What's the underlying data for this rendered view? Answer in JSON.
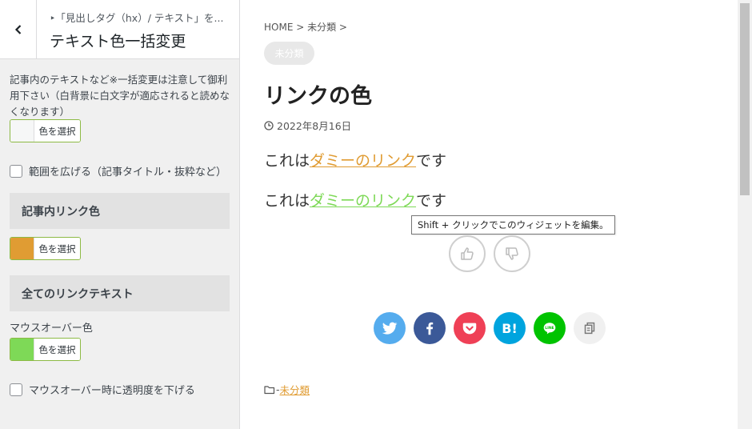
{
  "panel": {
    "breadcrumb": "‣「見出しタグ（hx）/ テキスト」を...",
    "title": "テキスト色一括変更",
    "text_color": {
      "description": "記事内のテキストなど※一括変更は注意して御利用下さい（白背景に白文字が適応されると読めなくなります）",
      "button_label": "色を選択",
      "swatch_color": "#f6f7f7"
    },
    "widen_checkbox_label": "範囲を広げる（記事タイトル・抜粋など）",
    "link_color": {
      "heading": "記事内リンク色",
      "button_label": "色を選択",
      "swatch_color": "#e09c33"
    },
    "all_links": {
      "heading": "全てのリンクテキスト",
      "hover_label": "マウスオーバー色",
      "button_label": "色を選択",
      "swatch_color": "#7ed957"
    },
    "opacity_checkbox_label": "マウスオーバー時に透明度を下げる"
  },
  "preview": {
    "breadcrumb": {
      "home": "HOME",
      "sep1": " > ",
      "category": "未分類",
      "sep2": " >"
    },
    "category_badge": "未分類",
    "title": "リンクの色",
    "date": "2022年8月16日",
    "para1": {
      "before": "これは",
      "link": "ダミーのリンク",
      "after": "です"
    },
    "para2": {
      "before": "これは",
      "link": "ダミーのリンク",
      "after": "です"
    },
    "tooltip": "Shift + クリックでこのウィジェットを編集。",
    "footer_category_prefix": "-",
    "footer_category": "未分類"
  },
  "icons": {
    "back": "chevron-left-icon",
    "clock": "clock-icon",
    "like": "thumbs-up-icon",
    "dislike": "thumbs-down-icon",
    "twitter": "twitter-icon",
    "facebook": "facebook-icon",
    "pocket": "pocket-icon",
    "hatena": "hatena-bookmark-icon",
    "line": "line-icon",
    "copy": "copy-icon",
    "folder": "folder-icon"
  },
  "colors": {
    "twitter": "#55acee",
    "facebook": "#3b5998",
    "pocket": "#ef4056",
    "hatena": "#00a4de",
    "line": "#00c300",
    "copy": "#f0f0f0",
    "link_color": "#e09c33",
    "hover_color": "#7ed957"
  },
  "share_labels": {
    "hatena": "B!",
    "line": "LINE"
  }
}
